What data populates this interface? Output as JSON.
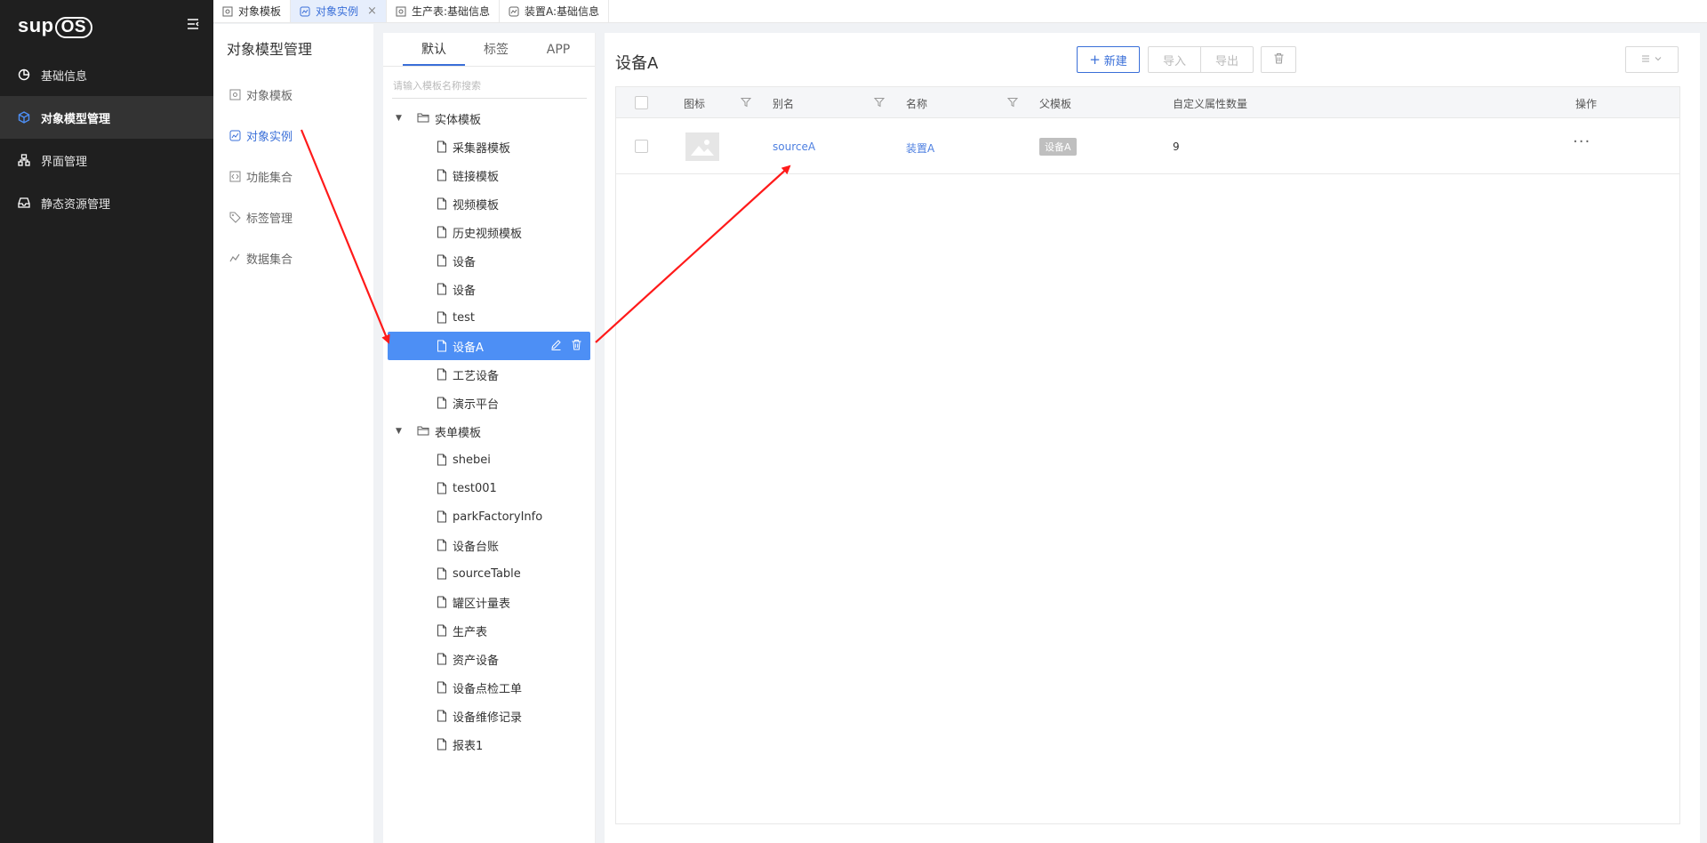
{
  "app": {
    "logo_main": "sup",
    "logo_os": "OS"
  },
  "sidebar": {
    "items": [
      {
        "label": "基础信息",
        "icon": "pie-chart-icon"
      },
      {
        "label": "对象模型管理",
        "icon": "cube-icon",
        "active": true
      },
      {
        "label": "界面管理",
        "icon": "sitemap-icon"
      },
      {
        "label": "静态资源管理",
        "icon": "inbox-icon"
      }
    ]
  },
  "tabs": [
    {
      "label": "对象模板",
      "icon": "template-icon"
    },
    {
      "label": "对象实例",
      "icon": "instance-icon",
      "active": true,
      "closable": "×"
    },
    {
      "label": "生产表:基础信息",
      "icon": "template-icon"
    },
    {
      "label": "装置A:基础信息",
      "icon": "instance-icon"
    }
  ],
  "subnav": {
    "title": "对象模型管理",
    "items": [
      {
        "label": "对象模板",
        "icon": "template-icon"
      },
      {
        "label": "对象实例",
        "icon": "instance-icon",
        "active": true
      },
      {
        "label": "功能集合",
        "icon": "code-icon"
      },
      {
        "label": "标签管理",
        "icon": "tag-icon"
      },
      {
        "label": "数据集合",
        "icon": "trend-icon"
      }
    ]
  },
  "tree": {
    "tabs": [
      "默认",
      "标签",
      "APP"
    ],
    "search_placeholder": "请输入模板名称搜索",
    "groups": [
      {
        "label": "实体模板",
        "items": [
          "采集器模板",
          "链接模板",
          "视频模板",
          "历史视频模板",
          "设备",
          "设备",
          "test",
          "设备A",
          "工艺设备",
          "演示平台"
        ]
      },
      {
        "label": "表单模板",
        "items": [
          "shebei",
          "test001",
          "parkFactoryInfo",
          "设备台账",
          "sourceTable",
          "罐区计量表",
          "生产表",
          "资产设备",
          "设备点检工单",
          "设备维修记录",
          "报表1"
        ]
      }
    ],
    "selected": "设备A"
  },
  "main": {
    "title": "设备A",
    "toolbar": {
      "new_label": "新建",
      "new_prefix": "+",
      "import_label": "导入",
      "export_label": "导出"
    },
    "table": {
      "columns": [
        "图标",
        "别名",
        "名称",
        "父模板",
        "自定义属性数量",
        "操作"
      ],
      "rows": [
        {
          "alias": "sourceA",
          "name": "装置A",
          "parent": "设备A",
          "attr_count": "9",
          "actions": "···"
        }
      ]
    }
  },
  "colors": {
    "accent": "#3a6fd8",
    "selected": "#4d8ff5",
    "sidebar_bg": "#1f1f1f",
    "arrow": "#ff1a1a"
  }
}
